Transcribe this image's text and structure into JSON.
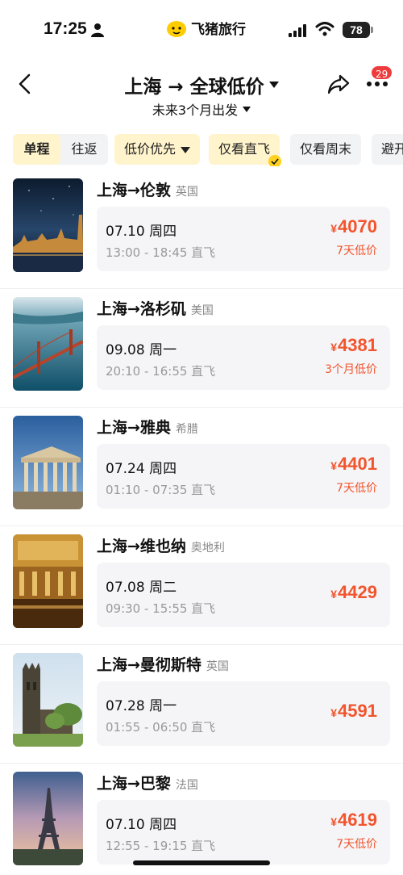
{
  "status_bar": {
    "time": "17:25",
    "battery": "78",
    "brand": "飞猪旅行",
    "icons": [
      "person-icon",
      "signal-icon",
      "wifi-icon",
      "battery-icon"
    ]
  },
  "header": {
    "title": "上海 → 全球低价",
    "subtitle": "未来3个月出发",
    "badge_count": "29",
    "icons": [
      "back-icon",
      "share-icon",
      "more-icon"
    ]
  },
  "filters": {
    "trip_type": [
      {
        "label": "单程",
        "active": true
      },
      {
        "label": "往返",
        "active": false
      }
    ],
    "chips": [
      {
        "label": "低价优先",
        "active": true,
        "dropdown": true
      },
      {
        "label": "仅看直飞",
        "active": true,
        "checked": true
      },
      {
        "label": "仅看周末",
        "active": false
      },
      {
        "label": "避开",
        "active": false
      }
    ]
  },
  "flights": [
    {
      "route": "上海→伦敦",
      "country": "英国",
      "date": "07.10 周四",
      "time": "13:00 - 18:45 直飞",
      "currency": "¥",
      "price": "4070",
      "note": "7天低价",
      "image": "london-night-photo"
    },
    {
      "route": "上海→洛杉矶",
      "country": "美国",
      "date": "09.08 周一",
      "time": "20:10 - 16:55 直飞",
      "currency": "¥",
      "price": "4381",
      "note": "3个月低价",
      "image": "golden-gate-bridge-photo"
    },
    {
      "route": "上海→雅典",
      "country": "希腊",
      "date": "07.24 周四",
      "time": "01:10 - 07:35 直飞",
      "currency": "¥",
      "price": "4401",
      "note": "7天低价",
      "image": "parthenon-photo"
    },
    {
      "route": "上海→维也纳",
      "country": "奥地利",
      "date": "07.08 周二",
      "time": "09:30 - 15:55 直飞",
      "currency": "¥",
      "price": "4429",
      "note": "",
      "image": "concert-hall-photo"
    },
    {
      "route": "上海→曼彻斯特",
      "country": "英国",
      "date": "07.28 周一",
      "time": "01:55 - 06:50 直飞",
      "currency": "¥",
      "price": "4591",
      "note": "",
      "image": "cathedral-tower-photo"
    },
    {
      "route": "上海→巴黎",
      "country": "法国",
      "date": "07.10 周四",
      "time": "12:55 - 19:15 直飞",
      "currency": "¥",
      "price": "4619",
      "note": "7天低价",
      "image": "eiffel-tower-photo"
    }
  ],
  "colors": {
    "accent_price": "#f2542d",
    "active_chip": "#fff4cc",
    "badge": "#ee3b3b"
  }
}
